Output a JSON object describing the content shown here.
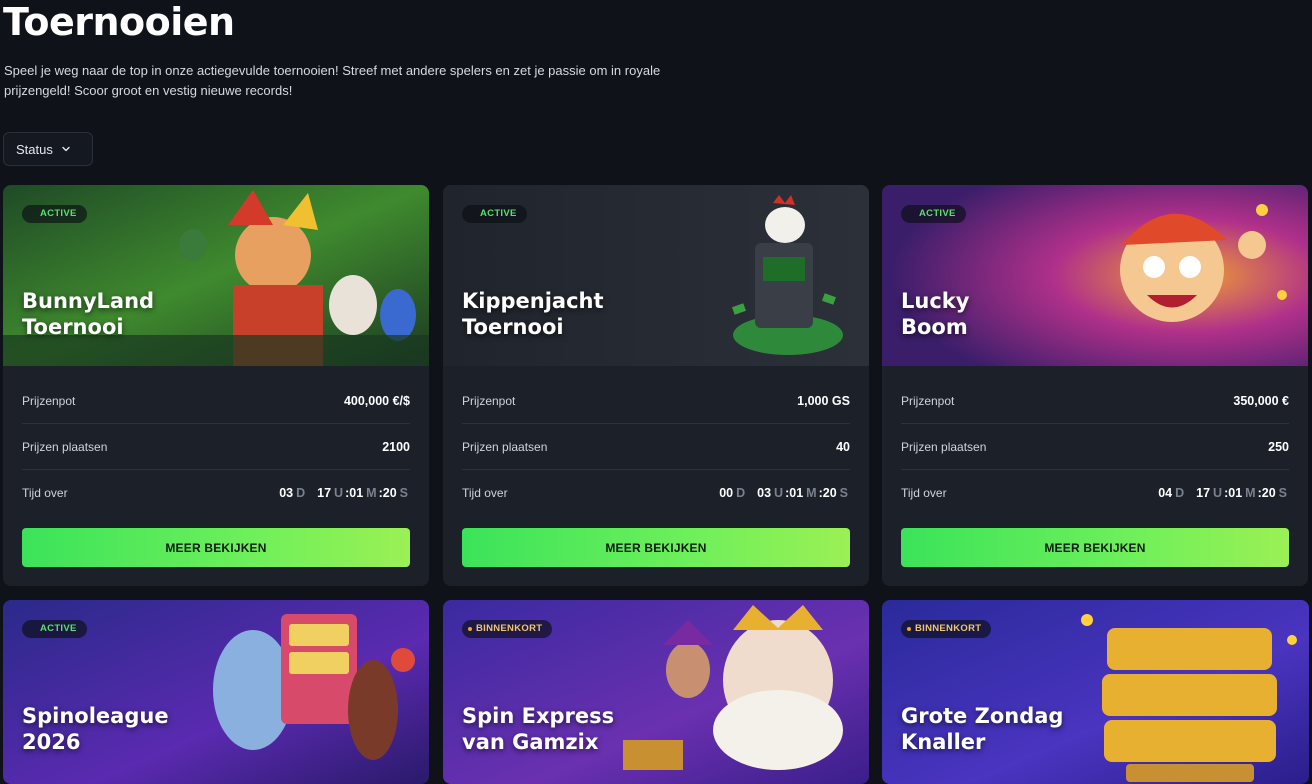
{
  "header": {
    "title": "Toernooien",
    "description": "Speel je weg naar de top in onze actiegevulde toernooien! Streef met andere spelers en zet je passie om in royale prijzengeld! Scoor groot en vestig nieuwe records!"
  },
  "filter": {
    "status_label": "Status"
  },
  "labels": {
    "prize_pool": "Prijzenpot",
    "prize_places": "Prijzen plaatsen",
    "time_left": "Tijd over",
    "cta": "MEER BEKIJKEN",
    "unit_d": "D",
    "unit_u": "U",
    "unit_m": "M",
    "unit_s": "S"
  },
  "tournaments": [
    {
      "status": "ACTIVE",
      "title_1": "BunnyLand",
      "title_2": "Toernooi",
      "prize_pool": "400,000 €/$",
      "prize_places": "2100",
      "d": "03",
      "u": "17",
      "m": "01",
      "s": "20",
      "accent": "#2f7a2a"
    },
    {
      "status": "ACTIVE",
      "title_1": "Kippenjacht",
      "title_2": "Toernooi",
      "prize_pool": "1,000 GS",
      "prize_places": "40",
      "d": "00",
      "u": "03",
      "m": "01",
      "s": "20",
      "accent": "#24282f"
    },
    {
      "status": "ACTIVE",
      "title_1": "Lucky",
      "title_2": "Boom",
      "prize_pool": "350,000 €",
      "prize_places": "250",
      "d": "04",
      "u": "17",
      "m": "01",
      "s": "20",
      "accent": "#6a2aa0"
    },
    {
      "status": "ACTIVE",
      "title_1": "Spinoleague",
      "title_2": "2026",
      "accent": "#3b2a9a"
    },
    {
      "status": "BINNENKORT",
      "title_1": "Spin Express",
      "title_2": "van Gamzix",
      "accent": "#4a2aa8"
    },
    {
      "status": "BINNENKORT",
      "title_1": "Grote Zondag",
      "title_2": "Knaller",
      "accent": "#3a2fb0"
    }
  ],
  "colors": {
    "background": "#0f1219",
    "card": "#1c2029",
    "active_badge": "#58e06a",
    "soon_badge": "#f1c66f",
    "cta_green": "#3be35a"
  }
}
